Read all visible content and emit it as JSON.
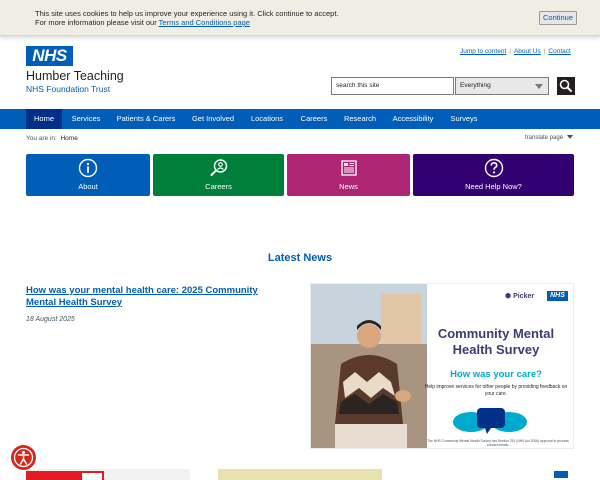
{
  "cookie": {
    "line1": "This site uses cookies to help us improve your experience using it. Click continue to accept.",
    "line2_prefix": "For more information please visit our ",
    "link": "Terms and Conditions page",
    "button": "Continue"
  },
  "header": {
    "logo": "NHS",
    "org_name": "Humber Teaching",
    "org_sub": "NHS Foundation Trust",
    "util_links": [
      "Jump to content",
      "About Us",
      "Contact"
    ],
    "search_placeholder": "search this site",
    "search_scope": "Everything"
  },
  "nav": {
    "items": [
      "Home",
      "Services",
      "Patients & Carers",
      "Get Involved",
      "Locations",
      "Careers",
      "Research",
      "Accessibility",
      "Surveys"
    ]
  },
  "breadcrumb": {
    "prefix": "You are in:",
    "current": "Home"
  },
  "translate": "translate page",
  "tiles": [
    {
      "label": "About",
      "color": "#005eb8",
      "icon": "info-icon"
    },
    {
      "label": "Careers",
      "color": "#007f3b",
      "icon": "search-person-icon"
    },
    {
      "label": "News",
      "color": "#ae2573",
      "icon": "newspaper-icon"
    },
    {
      "label": "Need Help Now?",
      "color": "#330072",
      "icon": "question-icon"
    }
  ],
  "latest_news": {
    "title": "Latest News",
    "article_title": "How was your mental health care: 2025 Community Mental Health Survey",
    "date": "18 August 2025",
    "image": {
      "picker": "Picker",
      "nhs": "NHS",
      "heading": "Community Mental Health Survey",
      "subheading": "How was your care?",
      "body": "Help improve services for other people by providing feedback on your care.",
      "footnote": "The NHS Community Mental Health Survey has Section 251 (NHS Act 2006) approval to process contact details."
    }
  },
  "colors": {
    "nhs_blue": "#005eb8",
    "nav_active": "#003087",
    "accessibility_red": "#d5281b"
  }
}
